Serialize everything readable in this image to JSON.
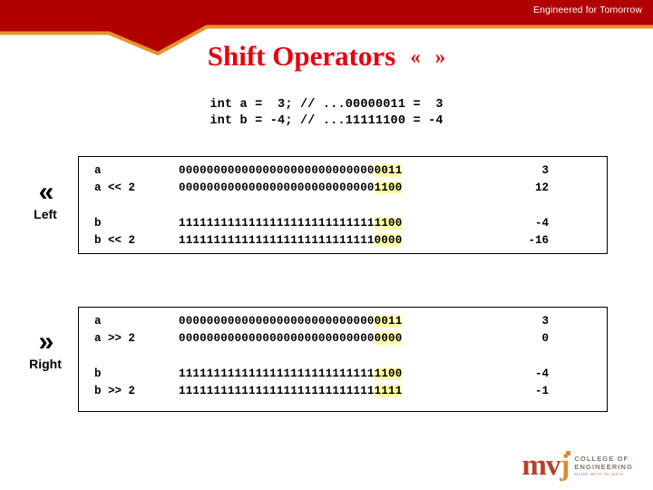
{
  "header": {
    "tagline": "Engineered for Tomorrow",
    "banner_red": "#b00000",
    "banner_orange": "#e8922e"
  },
  "title": {
    "main": "Shift Operators",
    "op_left": "«",
    "op_right": "»",
    "color": "#e8000d"
  },
  "declaration": {
    "line1": "int a =  3; // ...00000011 =  3",
    "line2": "int b = -4; // ...11111100 = -4"
  },
  "highlight_color": "#ffffaa",
  "sections": [
    {
      "id": "left",
      "arrows": "«",
      "word": "Left",
      "groups": [
        {
          "rows": [
            {
              "expr": "a",
              "bits_plain": "0000000000000000000000000000",
              "bits_hl": "0011",
              "value": "3"
            },
            {
              "expr": "a << 2",
              "bits_plain": "0000000000000000000000000000",
              "bits_hl": "1100",
              "value": "12"
            }
          ]
        },
        {
          "rows": [
            {
              "expr": "b",
              "bits_plain": "1111111111111111111111111111",
              "bits_hl": "1100",
              "value": "-4"
            },
            {
              "expr": "b << 2",
              "bits_plain": "1111111111111111111111111111",
              "bits_hl": "0000",
              "value": "-16"
            }
          ]
        }
      ]
    },
    {
      "id": "right",
      "arrows": "»",
      "word": "Right",
      "groups": [
        {
          "rows": [
            {
              "expr": "a",
              "bits_plain": "0000000000000000000000000000",
              "bits_hl": "0011",
              "value": "3"
            },
            {
              "expr": "a >> 2",
              "bits_plain": "0000000000000000000000000000",
              "bits_hl": "0000",
              "value": "0"
            }
          ]
        },
        {
          "rows": [
            {
              "expr": "b",
              "bits_plain": "1111111111111111111111111111",
              "bits_hl": "1100",
              "value": "-4"
            },
            {
              "expr": "b >> 2",
              "bits_plain": "1111111111111111111111111111",
              "bits_hl": "1111",
              "value": "-1"
            }
          ]
        }
      ]
    }
  ],
  "logo": {
    "mark_mv": "mv",
    "mark_j": "j",
    "line1": "COLLEGE OF",
    "line2": "ENGINEERING",
    "line3": "MADE WITH IN INDIA"
  }
}
